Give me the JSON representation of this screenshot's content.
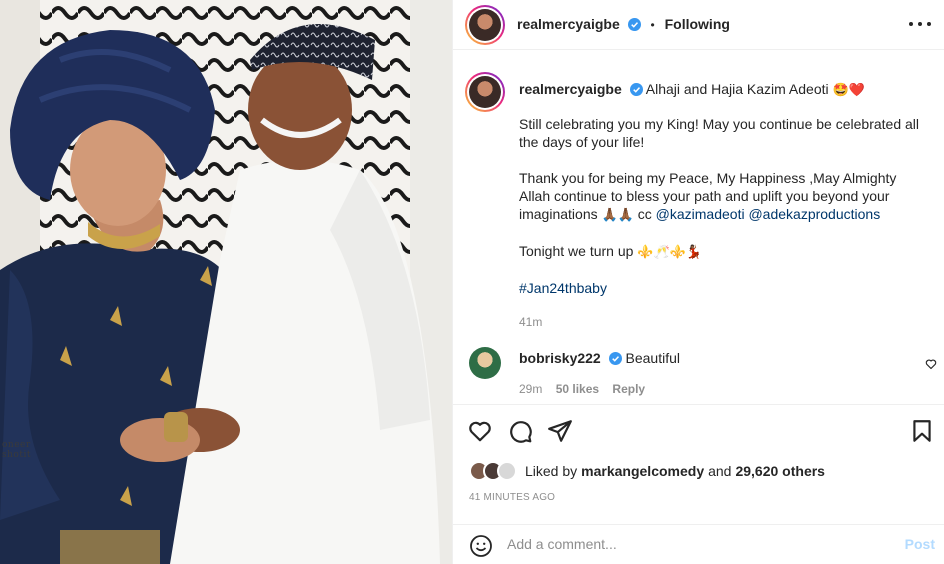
{
  "photo": {
    "watermark_line1": "oneer",
    "watermark_line2": "shotit"
  },
  "post": {
    "author": "realmercyaigbe",
    "separator": "•",
    "follow_status": "Following",
    "caption": {
      "line1": "Alhaji and Hajia Kazim Adeoti",
      "line1_emoji": "🤩❤️",
      "para1": "Still celebrating you my King! May you continue be celebrated all the days of your life!",
      "para2": "Thank you for being my Peace, My Happiness ,May Almighty Allah continue to bless your path and uplift you beyond your imaginations",
      "para2_emoji": "🙏🏾🙏🏾",
      "cc": "cc",
      "mention1": "@kazimadeoti",
      "mention2": "@adekazproductions",
      "para3": "Tonight we turn up",
      "para3_emoji": "⚜️🥂⚜️💃🏾",
      "hashtag": "#Jan24thbaby",
      "time": "41m"
    },
    "comment": {
      "user": "bobrisky222",
      "text": "Beautiful",
      "time": "29m",
      "likes": "50 likes",
      "reply": "Reply"
    },
    "likes": {
      "prefix": "Liked by",
      "user": "markangelcomedy",
      "and": "and",
      "others": "29,620 others"
    },
    "timestamp": "41 MINUTES AGO",
    "add_comment_placeholder": "Add a comment...",
    "post_label": "Post"
  },
  "colors": {
    "verified": "#3897f0",
    "link": "#00376b",
    "muted": "#8e8e8e",
    "post_disabled": "#b3dbff"
  }
}
